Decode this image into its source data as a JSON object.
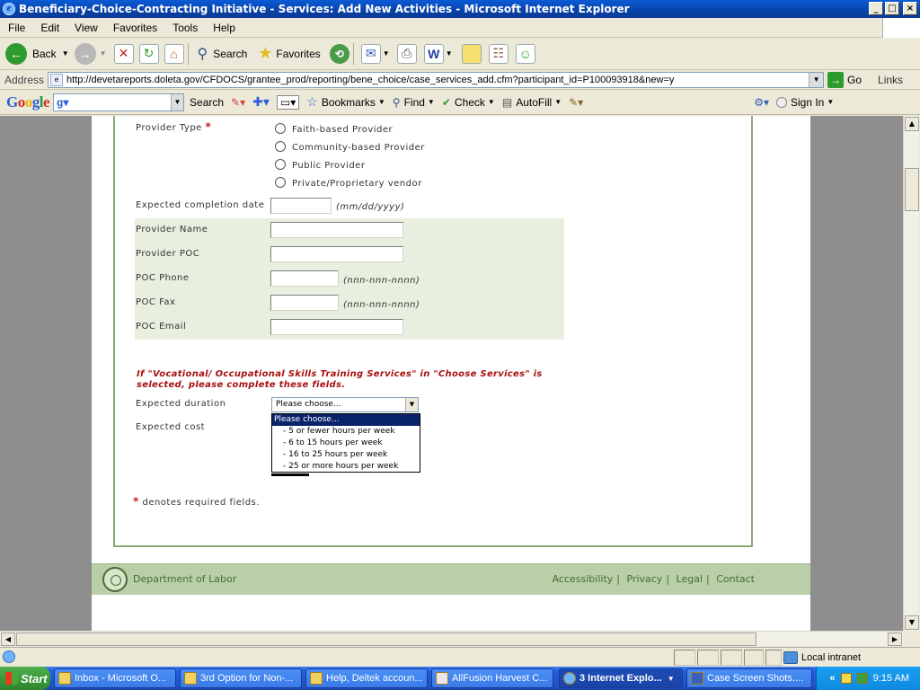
{
  "window": {
    "title": "Beneficiary-Choice-Contracting Initiative - Services: Add New Activities - Microsoft Internet Explorer"
  },
  "menu": [
    "File",
    "Edit",
    "View",
    "Favorites",
    "Tools",
    "Help"
  ],
  "toolbar": {
    "back": "Back",
    "search": "Search",
    "favorites": "Favorites"
  },
  "address": {
    "label": "Address",
    "url": "http://devetareports.doleta.gov/CFDOCS/grantee_prod/reporting/bene_choice/case_services_add.cfm?participant_id=P100093918&new=y",
    "go": "Go",
    "links": "Links"
  },
  "google_bar": {
    "logo": "Google",
    "search_label": "Search",
    "bookmarks": "Bookmarks",
    "find": "Find",
    "check": "Check",
    "autofill": "AutoFill",
    "sign_in": "Sign In"
  },
  "form": {
    "provider_type": {
      "label": "Provider Type",
      "required_mark": "*",
      "options": [
        "Faith-based Provider",
        "Community-based Provider",
        "Public Provider",
        "Private/Proprietary vendor"
      ]
    },
    "completion": {
      "label": "Expected completion date",
      "hint": "(mm/dd/yyyy)"
    },
    "provider_name": {
      "label": "Provider Name"
    },
    "provider_poc": {
      "label": "Provider POC"
    },
    "poc_phone": {
      "label": "POC Phone",
      "hint": "(nnn-nnn-nnnn)"
    },
    "poc_fax": {
      "label": "POC Fax",
      "hint": "(nnn-nnn-nnnn)"
    },
    "poc_email": {
      "label": "POC Email"
    },
    "warning": "If \"Vocational/ Occupational Skills Training Services\" in \"Choose Services\" is selected, please complete these fields.",
    "duration": {
      "label": "Expected duration",
      "selected": "Please choose...",
      "options": [
        "Please choose...",
        "- 5 or fewer hours per week",
        "- 6 to 15 hours per week",
        "- 16 to 25 hours per week",
        "- 25 or more hours per week"
      ]
    },
    "cost": {
      "label": "Expected cost"
    },
    "required_note": "denotes required fields."
  },
  "footer": {
    "org": "Department of Labor",
    "links": [
      "Accessibility",
      "Privacy",
      "Legal",
      "Contact"
    ]
  },
  "status": {
    "zone": "Local intranet"
  },
  "taskbar": {
    "start": "Start",
    "items": [
      "Inbox - Microsoft O...",
      "3rd Option for Non-...",
      "Help, Deltek accoun...",
      "AllFusion Harvest C...",
      "3 Internet Explo...",
      "Case Screen Shots...."
    ],
    "tray_arrows": "«",
    "time": "9:15 AM"
  }
}
